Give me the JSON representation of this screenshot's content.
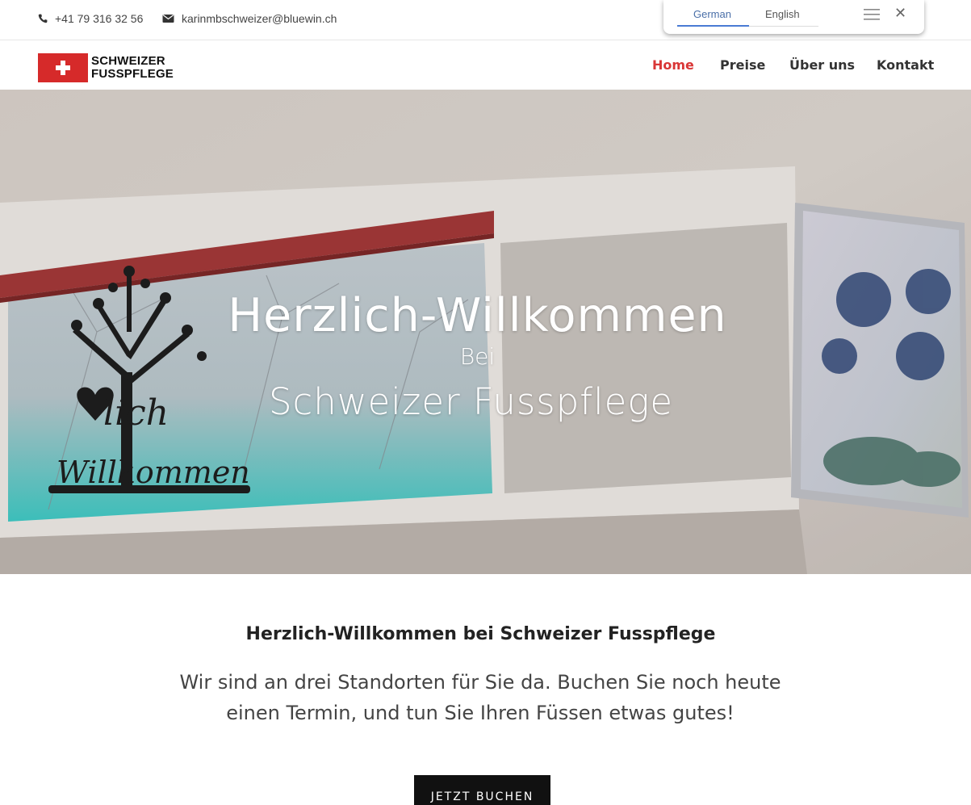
{
  "topbar": {
    "phone": "+41 79 316 32 56",
    "email": "karinmbschweizer@bluewin.ch",
    "phone_icon": "phone-icon",
    "email_icon": "envelope-icon"
  },
  "translate": {
    "languages": [
      "German",
      "English"
    ],
    "active": "German",
    "menu_icon": "hamburger-icon",
    "close_icon": "close-icon",
    "close_glyph": "✕"
  },
  "logo": {
    "line1": "SCHWEIZER",
    "line2": "FUSSPFLEGE"
  },
  "nav": {
    "items": [
      "Home",
      "Preise",
      "Über uns",
      "Kontakt"
    ],
    "active": "Home",
    "active_color": "#d93636"
  },
  "hero": {
    "line1": "Herzlich-Willkommen",
    "line2": "Bei",
    "line3": "Schweizer Fusspflege"
  },
  "intro": {
    "heading": "Herzlich-Willkommen bei Schweizer Fusspflege",
    "text": "Wir sind an drei Standorten für Sie da. Buchen Sie noch heute einen Termin, und tun Sie Ihren Füssen etwas gutes!"
  },
  "cta": {
    "label": "JETZT BUCHEN"
  }
}
